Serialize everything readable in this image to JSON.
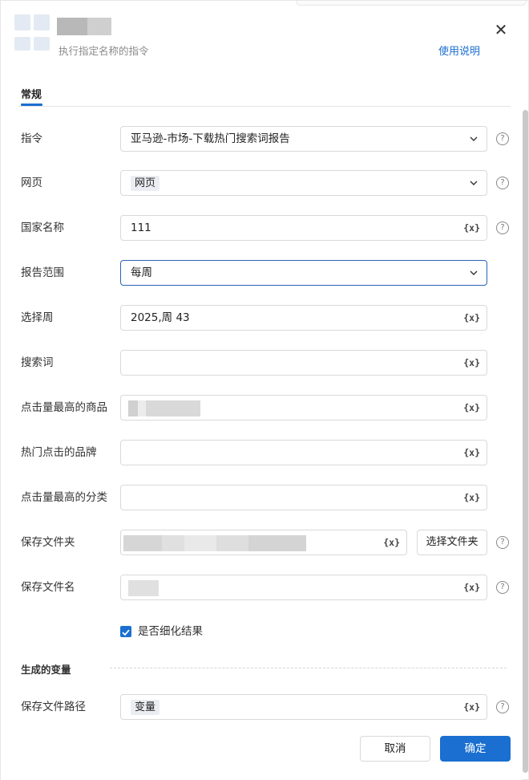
{
  "header": {
    "subtitle": "执行指定名称的指令",
    "help_link": "使用说明",
    "close_glyph": "✕"
  },
  "tabs": [
    {
      "label": "常规",
      "active": true
    }
  ],
  "form": {
    "command": {
      "label": "指令",
      "value": "亚马逊-市场-下载热门搜索词报告"
    },
    "webpage": {
      "label": "网页",
      "chip": "网页"
    },
    "country": {
      "label": "国家名称",
      "value": "111"
    },
    "report_range": {
      "label": "报告范围",
      "value": "每周"
    },
    "select_week": {
      "label": "选择周",
      "value": "2025,周 43"
    },
    "search_term": {
      "label": "搜索词",
      "value": ""
    },
    "top_clicked_product": {
      "label": "点击量最高的商品"
    },
    "top_clicked_brand": {
      "label": "热门点击的品牌",
      "value": ""
    },
    "top_clicked_category": {
      "label": "点击量最高的分类",
      "value": ""
    },
    "save_folder": {
      "label": "保存文件夹",
      "button": "选择文件夹"
    },
    "save_filename": {
      "label": "保存文件名"
    },
    "refine_results": {
      "label": "是否细化结果",
      "checked": true
    }
  },
  "variables_section": {
    "title": "生成的变量",
    "save_path": {
      "label": "保存文件路径",
      "chip": "变量"
    }
  },
  "icons": {
    "variable": "{x}",
    "help": "?"
  },
  "footer": {
    "cancel": "取消",
    "confirm": "确定"
  },
  "colors": {
    "accent": "#1a6fd0",
    "active_border": "#2a62b8"
  }
}
